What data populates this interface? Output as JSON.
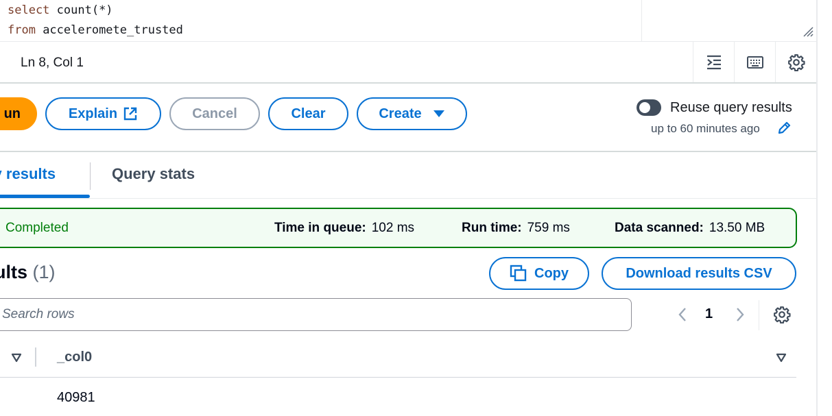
{
  "editor": {
    "line1_kw": "select",
    "line1_rest": " count(*)",
    "line2_kw": "from",
    "line2_rest": " acceleromete_trusted"
  },
  "statusbar": {
    "cursor": "Ln 8, Col 1",
    "icons": [
      "format-indent-icon",
      "keyboard-icon",
      "gear-icon"
    ]
  },
  "actions": {
    "run_label": "un",
    "explain_label": "Explain",
    "cancel_label": "Cancel",
    "clear_label": "Clear",
    "create_label": "Create",
    "reuse_label": "Reuse query results",
    "reuse_sub": "up to 60 minutes ago",
    "reuse_enabled": false
  },
  "tabs": [
    {
      "label": "ry results",
      "active": true
    },
    {
      "label": "Query stats",
      "active": false
    }
  ],
  "banner": {
    "status": "Completed",
    "queue_label": "Time in queue:",
    "queue_value": "102 ms",
    "runtime_label": "Run time:",
    "runtime_value": "759 ms",
    "scanned_label": "Data scanned:",
    "scanned_value": "13.50 MB"
  },
  "results": {
    "title": "ults",
    "count": "(1)",
    "copy_label": "Copy",
    "download_label": "Download results CSV",
    "search_placeholder": "Search rows",
    "page": "1",
    "columns": [
      "_col0"
    ],
    "rows": [
      [
        "40981"
      ]
    ]
  },
  "colors": {
    "accent": "#0972d3",
    "run": "#ff9900",
    "success": "#037f0c"
  }
}
